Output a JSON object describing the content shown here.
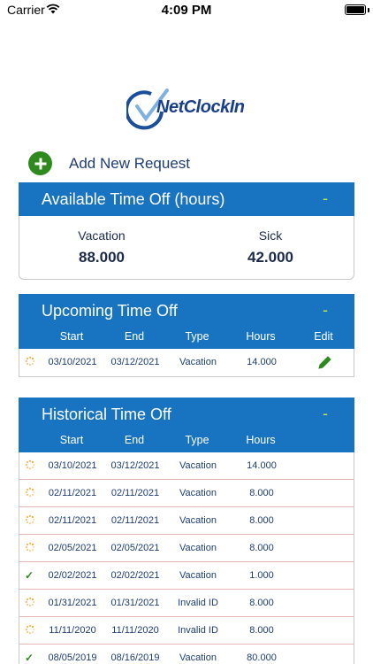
{
  "status": {
    "carrier": "Carrier",
    "time": "4:09 PM"
  },
  "logo": {
    "text": "NetClockIn"
  },
  "add_request": {
    "label": "Add New Request"
  },
  "available": {
    "title": "Available Time Off (hours)",
    "collapse": "-",
    "vacation_label": "Vacation",
    "vacation_value": "88.000",
    "sick_label": "Sick",
    "sick_value": "42.000"
  },
  "upcoming": {
    "title": "Upcoming Time Off",
    "collapse": "-",
    "columns": {
      "start": "Start",
      "end": "End",
      "type": "Type",
      "hours": "Hours",
      "edit": "Edit"
    },
    "rows": [
      {
        "status": "pending",
        "start": "03/10/2021",
        "end": "03/12/2021",
        "type": "Vacation",
        "hours": "14.000"
      }
    ]
  },
  "historical": {
    "title": "Historical Time Off",
    "collapse": "-",
    "columns": {
      "start": "Start",
      "end": "End",
      "type": "Type",
      "hours": "Hours"
    },
    "rows": [
      {
        "status": "pending",
        "start": "03/10/2021",
        "end": "03/12/2021",
        "type": "Vacation",
        "hours": "14.000"
      },
      {
        "status": "pending",
        "start": "02/11/2021",
        "end": "02/11/2021",
        "type": "Vacation",
        "hours": "8.000"
      },
      {
        "status": "pending",
        "start": "02/11/2021",
        "end": "02/11/2021",
        "type": "Vacation",
        "hours": "8.000"
      },
      {
        "status": "pending",
        "start": "02/05/2021",
        "end": "02/05/2021",
        "type": "Vacation",
        "hours": "8.000"
      },
      {
        "status": "approved",
        "start": "02/02/2021",
        "end": "02/02/2021",
        "type": "Vacation",
        "hours": "1.000"
      },
      {
        "status": "pending",
        "start": "01/31/2021",
        "end": "01/31/2021",
        "type": "Invalid ID",
        "hours": "8.000"
      },
      {
        "status": "pending",
        "start": "11/11/2020",
        "end": "11/11/2020",
        "type": "Invalid ID",
        "hours": "8.000"
      },
      {
        "status": "approved",
        "start": "08/05/2019",
        "end": "08/16/2019",
        "type": "Vacation",
        "hours": "80.000"
      }
    ]
  },
  "colors": {
    "header_blue": "#1874c1",
    "accent_green": "#2e8a1e",
    "collapse_yellow": "#c6e64d",
    "pending_orange": "#f0a020"
  }
}
